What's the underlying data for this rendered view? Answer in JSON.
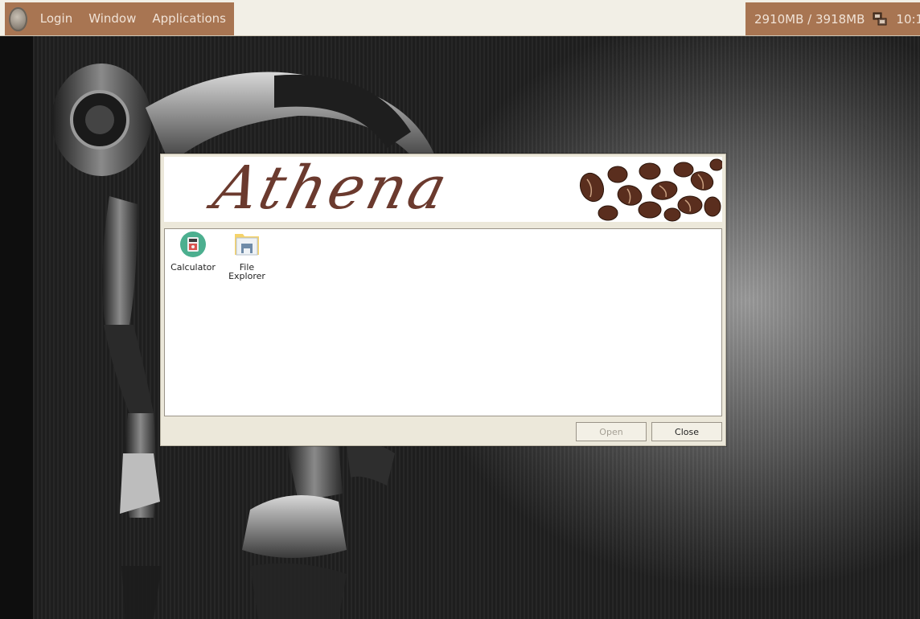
{
  "panel": {
    "menu": [
      {
        "label": "Login"
      },
      {
        "label": "Window"
      },
      {
        "label": "Applications"
      }
    ],
    "memory": "2910MB / 3918MB",
    "clock": "10:1"
  },
  "dialog": {
    "banner_title": "Athena",
    "apps": [
      {
        "label": "Calculator",
        "icon": "calculator-icon"
      },
      {
        "label": "File Explorer",
        "icon": "file-explorer-icon"
      }
    ],
    "buttons": {
      "open": "Open",
      "close": "Close"
    }
  },
  "colors": {
    "panel_accent": "#a87552",
    "panel_bg": "#f2efe6",
    "dialog_bg": "#ece8da",
    "banner_text": "#6b3a2e"
  }
}
